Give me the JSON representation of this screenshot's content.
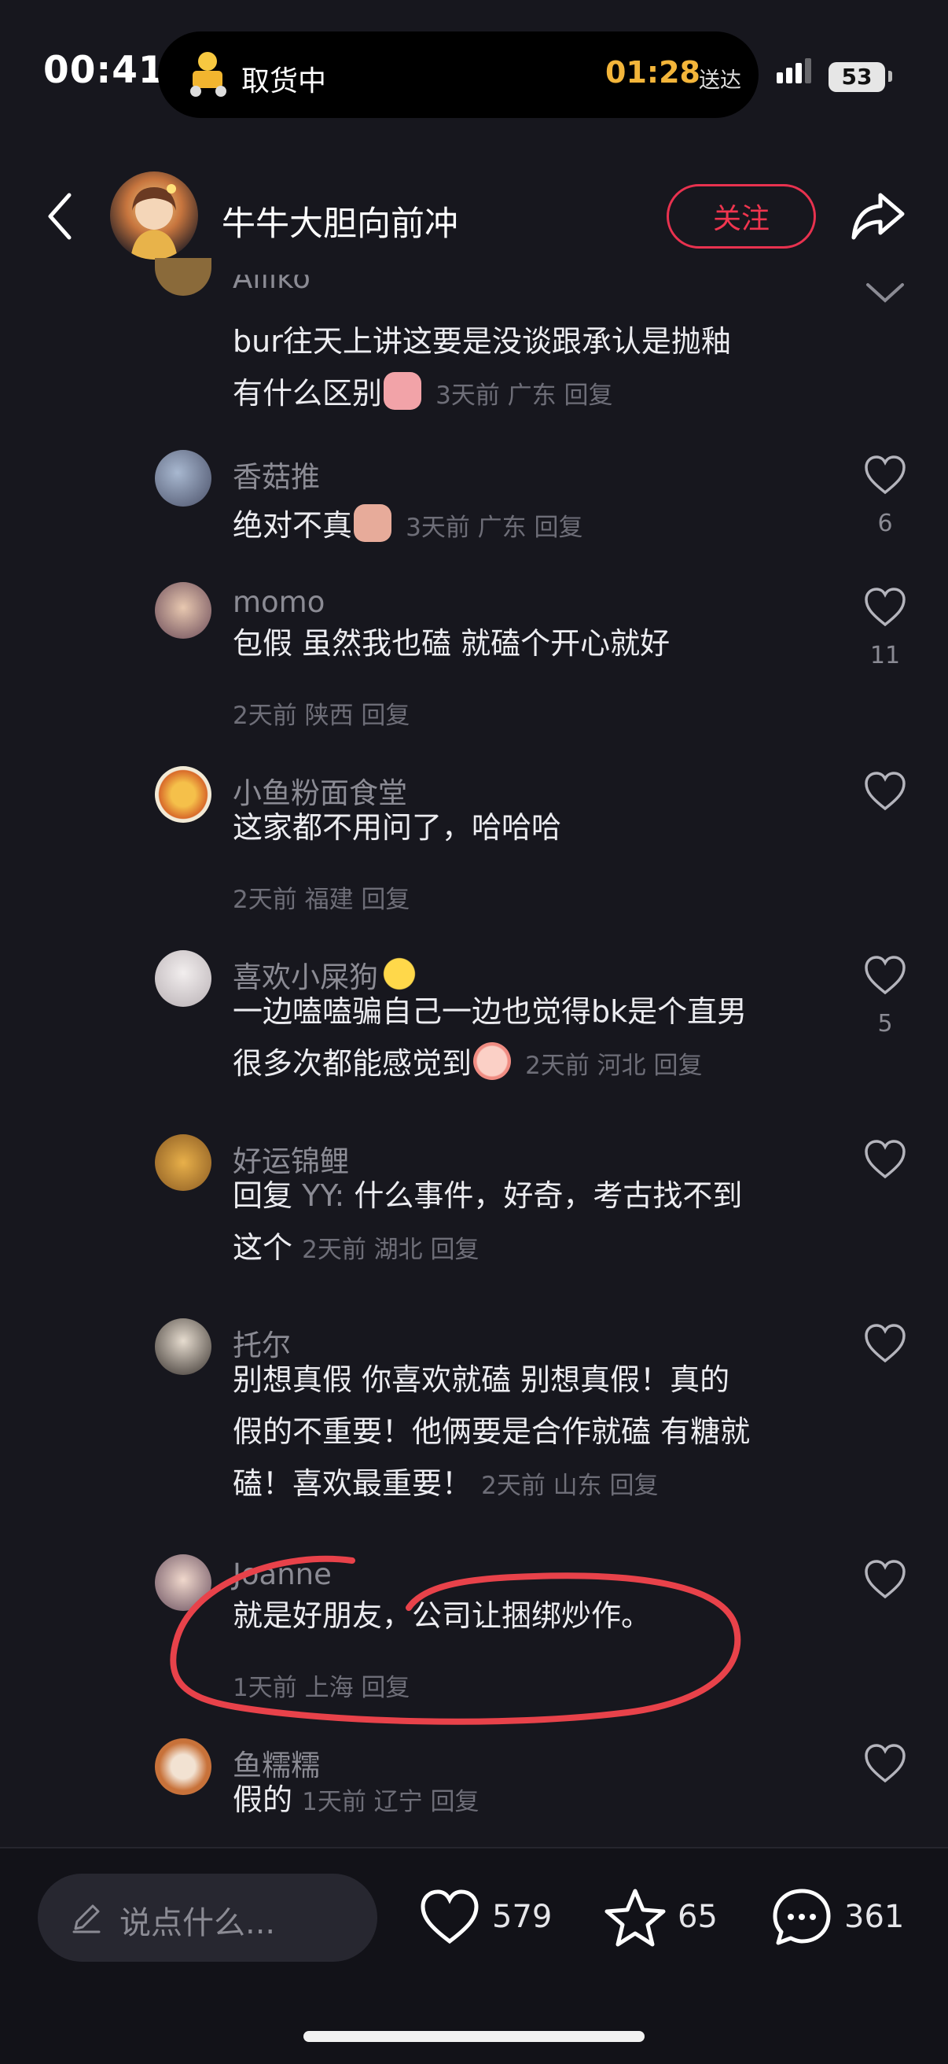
{
  "status_bar": {
    "time": "00:41",
    "island_text": "取货中",
    "island_eta": "01:28",
    "island_eta_suffix": "送达",
    "battery": "53"
  },
  "header": {
    "title": "牛牛大胆向前冲",
    "follow_label": "关注"
  },
  "comments": [
    {
      "name": "Ailiko",
      "text1": "bur往天上讲这要是没谈跟承认是抛釉",
      "text2": "有什么区别",
      "meta": "3天前 广东 回复",
      "likes": ""
    },
    {
      "name": "香菇推",
      "text1": "绝对不真",
      "meta": "3天前 广东 回复",
      "likes": "6"
    },
    {
      "name": "momo",
      "text1": "包假 虽然我也磕 就磕个开心就好",
      "meta": "2天前 陕西 回复",
      "likes": "11"
    },
    {
      "name": "小鱼粉面食堂",
      "text1": "这家都不用问了，哈哈哈",
      "meta": "2天前 福建 回复",
      "likes": ""
    },
    {
      "name": "喜欢小屎狗",
      "text1": "一边嗑嗑骗自己一边也觉得bk是个直男",
      "text2": "很多次都能感觉到",
      "meta": "2天前 河北 回复",
      "likes": "5"
    },
    {
      "name": "好运锦鲤",
      "text1_prefix": "回复 ",
      "text1_mention": "YY:",
      "text1": " 什么事件，好奇，考古找不到",
      "text2": "这个",
      "meta": "2天前 湖北 回复",
      "likes": ""
    },
    {
      "name": "托尔",
      "text1": "别想真假 你喜欢就磕 别想真假！真的",
      "text2": "假的不重要！他俩要是合作就磕 有糖就",
      "text3": "磕！喜欢最重要！",
      "meta": "2天前 山东 回复",
      "likes": ""
    },
    {
      "name": "Joanne",
      "text1": "就是好朋友，公司让捆绑炒作。",
      "meta": "1天前 上海 回复",
      "likes": ""
    },
    {
      "name": "鱼糯糯",
      "text1": "假的",
      "meta": "1天前 辽宁 回复",
      "likes": ""
    }
  ],
  "bottom_bar": {
    "input_placeholder": "说点什么...",
    "likes": "579",
    "favorites": "65",
    "comments": "361"
  },
  "colors": {
    "background": "#17171e",
    "accent": "#e8324f",
    "annotation": "#e8424a"
  }
}
